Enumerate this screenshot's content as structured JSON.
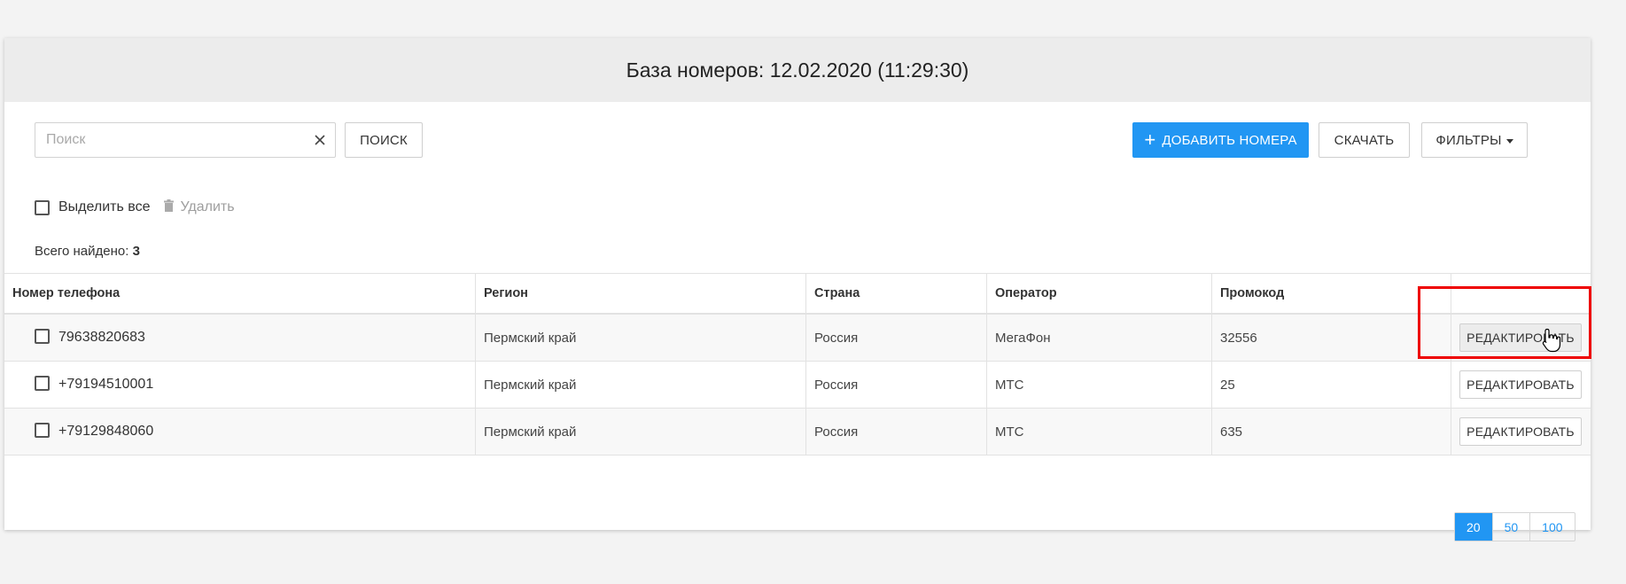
{
  "header": {
    "title": "База номеров: 12.02.2020 (11:29:30)"
  },
  "search": {
    "placeholder": "Поиск",
    "value": "",
    "button_label": "ПОИСК"
  },
  "toolbar": {
    "add_label": "ДОБАВИТЬ НОМЕРА",
    "download_label": "СКАЧАТЬ",
    "filters_label": "ФИЛЬТРЫ"
  },
  "selection": {
    "select_all_label": "Выделить все",
    "delete_label": "Удалить"
  },
  "summary": {
    "total_label": "Всего найдено:",
    "total_count": "3"
  },
  "table": {
    "columns": [
      "Номер телефона",
      "Регион",
      "Страна",
      "Оператор",
      "Промокод",
      ""
    ],
    "rows": [
      {
        "phone": "79638820683",
        "region": "Пермский край",
        "country": "Россия",
        "operator": "МегаФон",
        "promo": "32556",
        "action": "РЕДАКТИРОВАТЬ"
      },
      {
        "phone": "+79194510001",
        "region": "Пермский край",
        "country": "Россия",
        "operator": "МТС",
        "promo": "25",
        "action": "РЕДАКТИРОВАТЬ"
      },
      {
        "phone": "+79129848060",
        "region": "Пермский край",
        "country": "Россия",
        "operator": "МТС",
        "promo": "635",
        "action": "РЕДАКТИРОВАТЬ"
      }
    ]
  },
  "pagination": {
    "sizes": [
      "20",
      "50",
      "100"
    ],
    "active": "20"
  },
  "colors": {
    "primary": "#2196f3",
    "highlight": "#ee0000"
  },
  "icons": {
    "clear": "close-icon",
    "add": "plus-icon",
    "delete": "trash-icon",
    "filters": "caret-down-icon",
    "cursor": "hand-cursor-icon"
  }
}
